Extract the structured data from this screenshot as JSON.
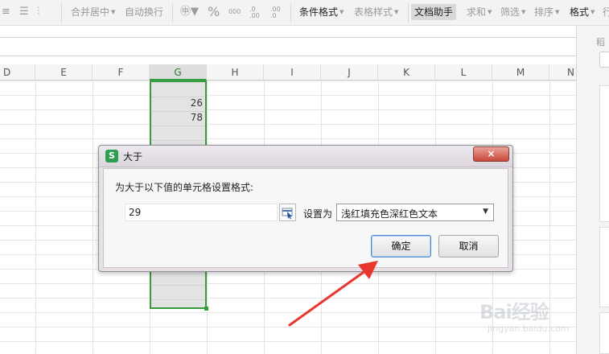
{
  "ribbon": {
    "merge_center": "合并居中",
    "wrap_text": "自动换行",
    "percent": "%",
    "thousands": "000",
    "decrease_decimal": ".0 .00",
    "increase_decimal": ".00 .0",
    "conditional_format": "条件格式",
    "table_style": "表格样式",
    "doc_assistant": "文档助手",
    "sum": "求和",
    "filter": "筛选",
    "sort": "排序",
    "format": "格式",
    "rows_cols": "行"
  },
  "columns": [
    "D",
    "E",
    "F",
    "G",
    "H",
    "I",
    "J",
    "K",
    "L",
    "M",
    "N"
  ],
  "selected_column": "G",
  "cells": {
    "g_row2": "26",
    "g_row3": "78"
  },
  "right_pane": {
    "label": "稻"
  },
  "dialog": {
    "icon_letter": "S",
    "title": "大于",
    "close": "×",
    "prompt": "为大于以下值的单元格设置格式:",
    "value": "29",
    "set_as": "设置为",
    "format_option": "浅红填充色深红色文本",
    "ok": "确定",
    "cancel": "取消"
  },
  "watermark": {
    "main": "Bai经验",
    "sub": "jingyan.baidu.com"
  },
  "colors": {
    "selection_border": "#3a9b3a",
    "arrow": "#e8352e",
    "close_button": "#c8473b"
  }
}
